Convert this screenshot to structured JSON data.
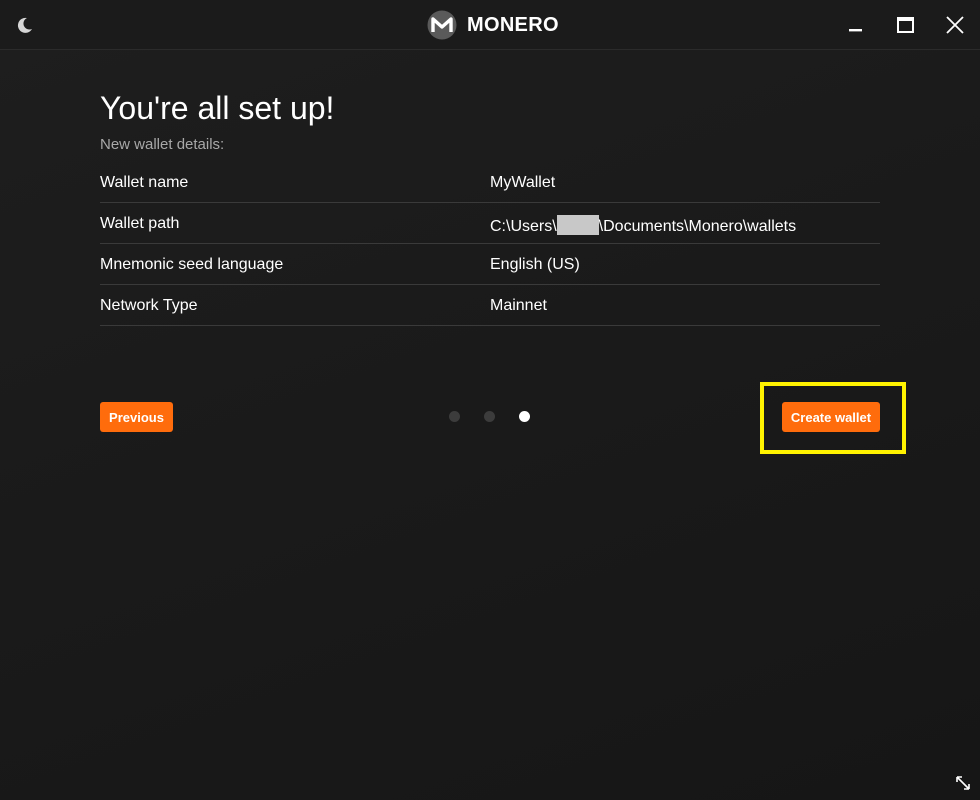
{
  "app": {
    "title": "MONERO"
  },
  "titlebar": {
    "theme_icon": "moon-icon",
    "minimize_icon": "minimize-icon",
    "maximize_icon": "maximize-icon",
    "close_icon": "close-icon"
  },
  "main": {
    "title": "You're all set up!",
    "subtitle": "New wallet details:",
    "details": [
      {
        "label": "Wallet name",
        "value": "MyWallet"
      },
      {
        "label": "Wallet path",
        "value_prefix": "C:\\Users\\",
        "value_suffix": "\\Documents\\Monero\\wallets"
      },
      {
        "label": "Mnemonic seed language",
        "value": "English (US)"
      },
      {
        "label": "Network Type",
        "value": "Mainnet"
      }
    ]
  },
  "navigation": {
    "previous_label": "Previous",
    "create_label": "Create wallet",
    "steps_total": 3,
    "current_step": 3
  },
  "colors": {
    "accent": "#ff6c0c",
    "highlight": "#fff200",
    "background": "#181818"
  }
}
